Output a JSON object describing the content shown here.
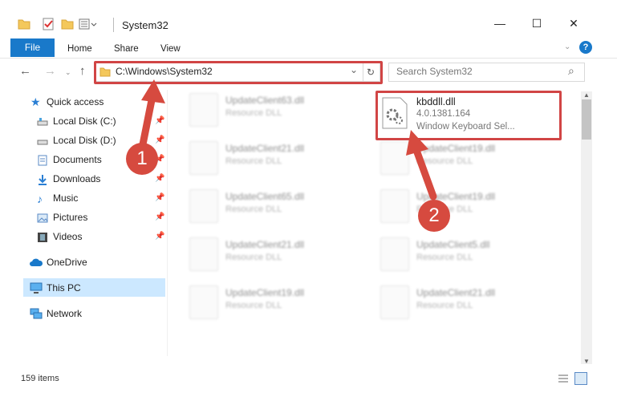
{
  "window": {
    "title": "System32",
    "minimize": "—",
    "maximize": "☐",
    "close": "✕"
  },
  "ribbon": {
    "tabs": [
      "File",
      "Home",
      "Share",
      "View"
    ],
    "help": "?"
  },
  "nav": {
    "back": "←",
    "forward": "→",
    "up": "↑",
    "address": "C:\\Windows\\System32",
    "search_placeholder": "Search System32",
    "dropdown": "⌄",
    "refresh": "↻",
    "search_icon": "⌕"
  },
  "sidebar": {
    "items": [
      {
        "label": "Quick access",
        "icon": "star-icon"
      },
      {
        "label": "Local Disk (C:)",
        "icon": "drive-icon"
      },
      {
        "label": "Local Disk (D:)",
        "icon": "drive-icon"
      },
      {
        "label": "Documents",
        "icon": "documents-icon"
      },
      {
        "label": "Downloads",
        "icon": "download-icon"
      },
      {
        "label": "Music",
        "icon": "music-icon"
      },
      {
        "label": "Pictures",
        "icon": "pictures-icon"
      },
      {
        "label": "Videos",
        "icon": "videos-icon"
      },
      {
        "label": "OneDrive",
        "icon": "cloud-icon"
      },
      {
        "label": "This PC",
        "icon": "computer-icon"
      },
      {
        "label": "Network",
        "icon": "network-icon"
      }
    ]
  },
  "files": {
    "col1": [
      {
        "name": "UpdateClient63.dll",
        "desc": "Resource DLL"
      },
      {
        "name": "UpdateClient21.dll",
        "desc": "Resource DLL"
      },
      {
        "name": "UpdateClient65.dll",
        "desc": "Resource DLL"
      },
      {
        "name": "UpdateClient21.dll",
        "desc": "Resource DLL"
      },
      {
        "name": "UpdateClient19.dll",
        "desc": "Resource DLL"
      }
    ],
    "col2": [
      {
        "name": "UpdateClient19.dll",
        "desc": "Resource DLL"
      },
      {
        "name": "UpdateClient19.dll",
        "desc": "Resource DLL"
      },
      {
        "name": "UpdateClient5.dll",
        "desc": "Resource DLL"
      },
      {
        "name": "UpdateClient21.dll",
        "desc": "Resource DLL"
      }
    ],
    "highlight": {
      "name": "kbddll.dll",
      "version": "4.0.1381.164",
      "desc": "Window Keyboard Sel..."
    }
  },
  "annotations": {
    "step1": "1",
    "step2": "2",
    "color": "#d64a3f"
  },
  "status": {
    "count": "159 items"
  }
}
